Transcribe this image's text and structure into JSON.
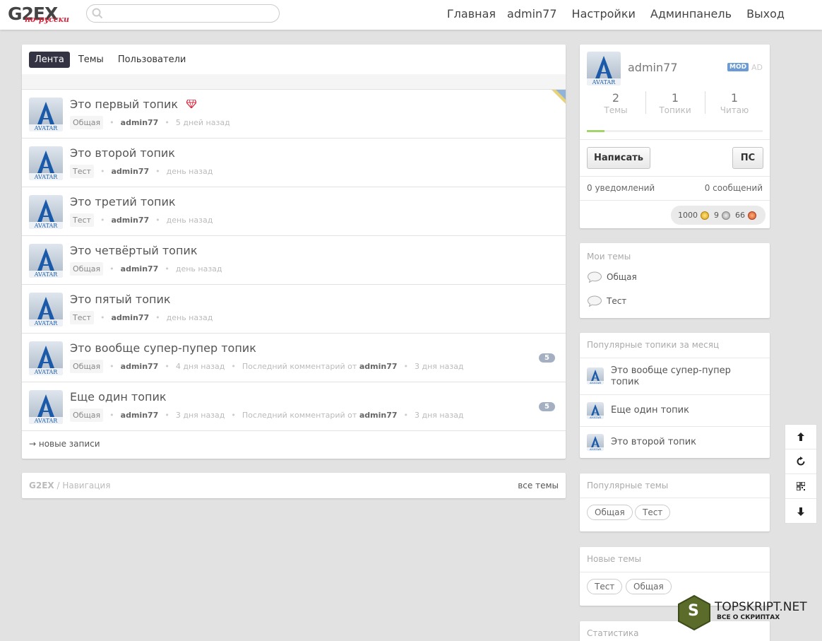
{
  "header": {
    "logo": "G2EX",
    "logo_sub": "по-русски",
    "search_placeholder": "",
    "nav": [
      "Главная",
      "admin77",
      "Настройки",
      "Админпанель",
      "Выход"
    ]
  },
  "main": {
    "tabs": [
      "Лента",
      "Темы",
      "Пользователи"
    ],
    "more_link": "→ новые записи",
    "topics": [
      {
        "title": "Это первый топик",
        "node": "Общая",
        "author": "admin77",
        "time": "5 дней назад",
        "gem": true
      },
      {
        "title": "Это второй топик",
        "node": "Тест",
        "author": "admin77",
        "time": "день назад"
      },
      {
        "title": "Это третий топик",
        "node": "Тест",
        "author": "admin77",
        "time": "день назад"
      },
      {
        "title": "Это четвёртый топик",
        "node": "Общая",
        "author": "admin77",
        "time": "день назад"
      },
      {
        "title": "Это пятый топик",
        "node": "Тест",
        "author": "admin77",
        "time": "день назад"
      },
      {
        "title": "Это вообще супер-пупер топик",
        "node": "Общая",
        "author": "admin77",
        "time": "4 дня назад",
        "last_label": "Последний комментарий от",
        "last_author": "admin77",
        "last_time": "3 дня назад",
        "count": "5"
      },
      {
        "title": "Еще один топик",
        "node": "Общая",
        "author": "admin77",
        "time": "3 дня назад",
        "last_label": "Последний комментарий от",
        "last_author": "admin77",
        "last_time": "3 дня назад",
        "count": "5"
      }
    ]
  },
  "nav_card": {
    "brand": "G2EX",
    "sep": " / ",
    "label": "Навигация",
    "all_link": "все темы"
  },
  "profile": {
    "username": "admin77",
    "mod_badge": "MOD",
    "ad_badge": "AD",
    "stats": [
      {
        "value": "2",
        "label": "Темы"
      },
      {
        "value": "1",
        "label": "Топики"
      },
      {
        "value": "1",
        "label": "Читаю"
      }
    ],
    "progress": 0.1,
    "write_button": "Написать",
    "pm_button": "ПС",
    "notifications": "0 уведомлений",
    "messages": "0 сообщений",
    "balance": {
      "gold": "1000",
      "silver": "9",
      "bronze": "66"
    }
  },
  "my_nodes": {
    "title": "Мои темы",
    "items": [
      "Общая",
      "Тест"
    ]
  },
  "popular_topics": {
    "title": "Популярные топики за месяц",
    "items": [
      "Это вообще супер-пупер топик",
      "Еще один топик",
      "Это второй топик"
    ]
  },
  "popular_nodes": {
    "title": "Популярные темы",
    "items": [
      "Общая",
      "Тест"
    ]
  },
  "new_nodes": {
    "title": "Новые темы",
    "items": [
      "Тест",
      "Общая"
    ]
  },
  "stats_widget": {
    "title": "Статистика"
  },
  "watermark": {
    "text": "TOPSKRIPT.NET",
    "sub": "ВСЕ О СКРИПТАХ",
    "letter": "S"
  },
  "colors": {
    "accent": "#334455",
    "badge": "#a4b0c2",
    "mod": "#6b9bd2",
    "progress": "#a3d46c"
  }
}
